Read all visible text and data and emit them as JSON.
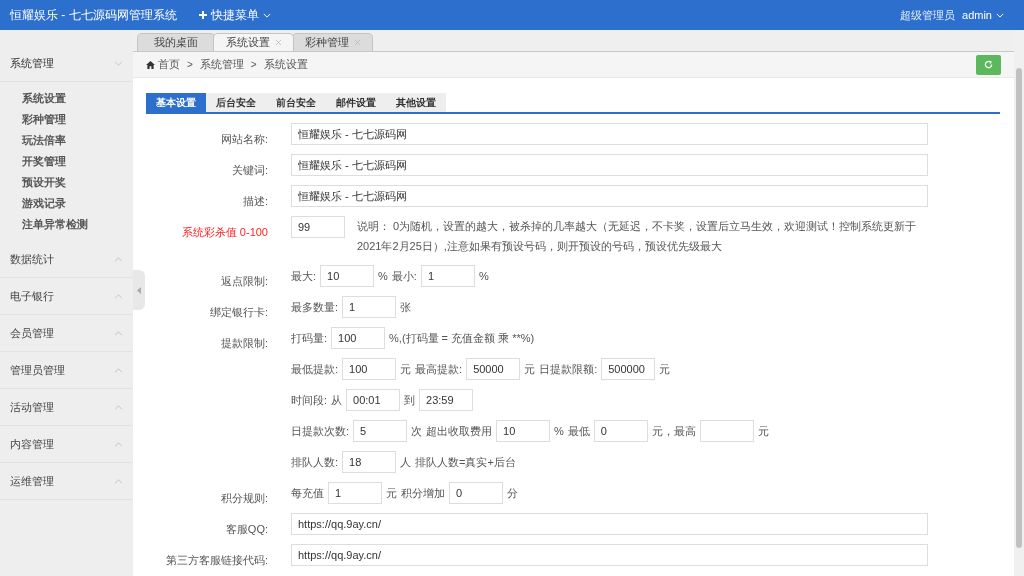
{
  "header": {
    "title": "恒耀娱乐 - 七七源码网管理系统",
    "quick_menu": "快捷菜单",
    "role": "超级管理员",
    "user": "admin"
  },
  "sidebar": {
    "groups": [
      {
        "label": "系统管理",
        "expanded": true,
        "children": [
          {
            "label": "系统设置"
          },
          {
            "label": "彩种管理"
          },
          {
            "label": "玩法倍率"
          },
          {
            "label": "开奖管理"
          },
          {
            "label": "预设开奖"
          },
          {
            "label": "游戏记录"
          },
          {
            "label": "注单异常检测"
          }
        ]
      },
      {
        "label": "数据统计",
        "expanded": false
      },
      {
        "label": "电子银行",
        "expanded": false
      },
      {
        "label": "会员管理",
        "expanded": false
      },
      {
        "label": "管理员管理",
        "expanded": false
      },
      {
        "label": "活动管理",
        "expanded": false
      },
      {
        "label": "内容管理",
        "expanded": false
      },
      {
        "label": "运维管理",
        "expanded": false
      }
    ]
  },
  "page_tabs": [
    {
      "label": "我的桌面",
      "selected": false,
      "closable": false
    },
    {
      "label": "系统设置",
      "selected": true,
      "closable": true
    },
    {
      "label": "彩种管理",
      "selected": false,
      "closable": true
    }
  ],
  "breadcrumb": [
    "首页",
    "系统管理",
    "系统设置"
  ],
  "breadcrumb_separator": ">",
  "settings_tabs": [
    {
      "label": "基本设置",
      "selected": true
    },
    {
      "label": "后台安全",
      "selected": false
    },
    {
      "label": "前台安全",
      "selected": false
    },
    {
      "label": "邮件设置",
      "selected": false
    },
    {
      "label": "其他设置",
      "selected": false
    }
  ],
  "form": [
    {
      "label": "网站名称:",
      "items": [
        {
          "kind": "wide",
          "value": "恒耀娱乐 - 七七源码网"
        }
      ]
    },
    {
      "label": "关键词:",
      "items": [
        {
          "kind": "wide",
          "value": "恒耀娱乐 - 七七源码网"
        }
      ]
    },
    {
      "label": "描述:",
      "items": [
        {
          "kind": "wide",
          "value": "恒耀娱乐 - 七七源码网"
        }
      ]
    },
    {
      "label": "系统彩杀值 0-100",
      "highlight": true,
      "items": [
        {
          "kind": "input",
          "value": "99"
        },
        {
          "kind": "note",
          "text": "说明： 0为随机，设置的越大，被杀掉的几率越大（无延迟，不卡奖，设置后立马生效，欢迎测试！控制系统更新于2021年2月25日）,注意如果有预设号码，则开预设的号码，预设优先级最大"
        }
      ]
    },
    {
      "label": "返点限制:",
      "items": [
        {
          "kind": "text",
          "text": "最大:"
        },
        {
          "kind": "input",
          "value": "10"
        },
        {
          "kind": "text",
          "text": "%"
        },
        {
          "kind": "text",
          "text": "最小:"
        },
        {
          "kind": "input",
          "value": "1"
        },
        {
          "kind": "text",
          "text": "%"
        }
      ]
    },
    {
      "label": "绑定银行卡:",
      "items": [
        {
          "kind": "text",
          "text": "最多数量:"
        },
        {
          "kind": "input",
          "value": "1"
        },
        {
          "kind": "text",
          "text": "张"
        }
      ]
    },
    {
      "label": "提款限制:",
      "items": [
        {
          "kind": "text",
          "text": "打码量:"
        },
        {
          "kind": "input",
          "value": "100"
        },
        {
          "kind": "text",
          "text": "%,(打码量 = 充值金额 乘 **%)"
        }
      ]
    },
    {
      "items": [
        {
          "kind": "text",
          "text": "最低提款:"
        },
        {
          "kind": "input",
          "value": "100"
        },
        {
          "kind": "text",
          "text": "元"
        },
        {
          "kind": "text",
          "text": "最高提款:"
        },
        {
          "kind": "input",
          "value": "50000"
        },
        {
          "kind": "text",
          "text": "元"
        },
        {
          "kind": "text",
          "text": "日提款限额:"
        },
        {
          "kind": "input",
          "value": "500000"
        },
        {
          "kind": "text",
          "text": "元"
        }
      ]
    },
    {
      "items": [
        {
          "kind": "text",
          "text": "时间段:"
        },
        {
          "kind": "text",
          "text": "从"
        },
        {
          "kind": "input",
          "value": "00:01"
        },
        {
          "kind": "text",
          "text": "到"
        },
        {
          "kind": "input",
          "value": "23:59"
        }
      ]
    },
    {
      "items": [
        {
          "kind": "text",
          "text": "日提款次数:"
        },
        {
          "kind": "input",
          "value": "5"
        },
        {
          "kind": "text",
          "text": "次"
        },
        {
          "kind": "text",
          "text": "超出收取费用"
        },
        {
          "kind": "input",
          "value": "10"
        },
        {
          "kind": "text",
          "text": "%"
        },
        {
          "kind": "text",
          "text": "最低"
        },
        {
          "kind": "input",
          "value": "0"
        },
        {
          "kind": "text",
          "text": "元，最高"
        },
        {
          "kind": "input"
        },
        {
          "kind": "text",
          "text": "元"
        }
      ]
    },
    {
      "items": [
        {
          "kind": "text",
          "text": "排队人数:"
        },
        {
          "kind": "input",
          "value": "18"
        },
        {
          "kind": "text",
          "text": "人"
        },
        {
          "kind": "text",
          "text": "排队人数=真实+后台"
        }
      ]
    },
    {
      "label": "积分规则:",
      "items": [
        {
          "kind": "text",
          "text": "每充值"
        },
        {
          "kind": "input",
          "value": "1"
        },
        {
          "kind": "text",
          "text": "元"
        },
        {
          "kind": "text",
          "text": "积分增加"
        },
        {
          "kind": "input",
          "value": "0"
        },
        {
          "kind": "text",
          "text": "分"
        }
      ]
    },
    {
      "label": "客服QQ:",
      "items": [
        {
          "kind": "wide",
          "value": "https://qq.9ay.cn/"
        }
      ]
    },
    {
      "label": "第三方客服链接代码:",
      "items": [
        {
          "kind": "wide",
          "value": "https://qq.9ay.cn/"
        }
      ]
    }
  ]
}
